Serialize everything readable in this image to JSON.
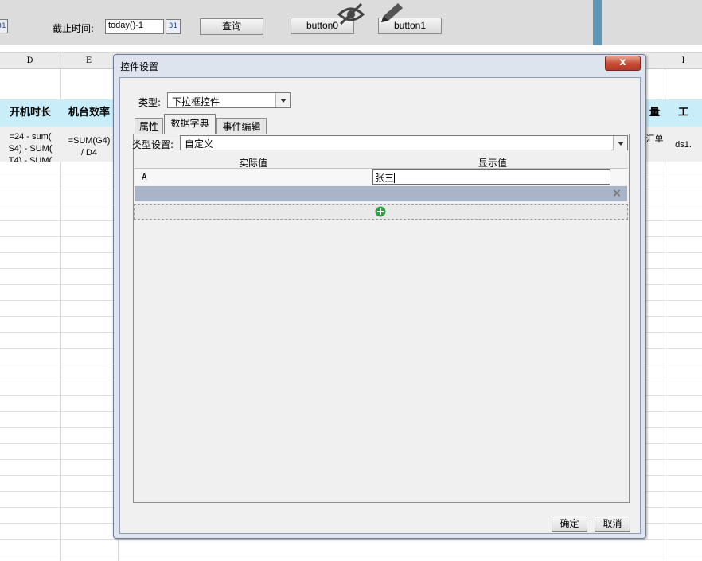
{
  "toolbar": {
    "deadline_label": "截止时间:",
    "deadline_value": "today()-1",
    "calendar_icon_text": "31",
    "query_label": "查询",
    "button0_label": "button0",
    "button1_label": "button1"
  },
  "sheet": {
    "columns": [
      "D",
      "E",
      "",
      "",
      "",
      "",
      "",
      "",
      "I"
    ],
    "headers": {
      "d": "开机时长",
      "e": "机台效率",
      "right1": "量",
      "right2": "工"
    },
    "formulas": {
      "d_line1": "=24 - sum(",
      "d_line2": "S4) - SUM(",
      "d_line3": "T4) - SUM(",
      "e_line1": "=SUM(G4)",
      "e_line2": "/ D4",
      "right1_line1": "汇单",
      "right2": "ds1."
    }
  },
  "dialog": {
    "title": "控件设置",
    "close_label": "x",
    "type_label": "类型:",
    "type_value": "下拉框控件",
    "tabs": [
      "属性",
      "数据字典",
      "事件编辑"
    ],
    "typeset_label": "类型设置:",
    "typeset_value": "自定义",
    "table": {
      "columns": [
        "实际值",
        "显示值"
      ],
      "rows": [
        {
          "actual": "A",
          "display": "张三"
        }
      ]
    },
    "delete_label": "×",
    "ok_label": "确定",
    "cancel_label": "取消"
  },
  "colors": {
    "header_cyan": "#c9eefa",
    "dialog_frame": "#dde4ee",
    "close_red": "#c64a33",
    "add_green": "#2ea043"
  }
}
